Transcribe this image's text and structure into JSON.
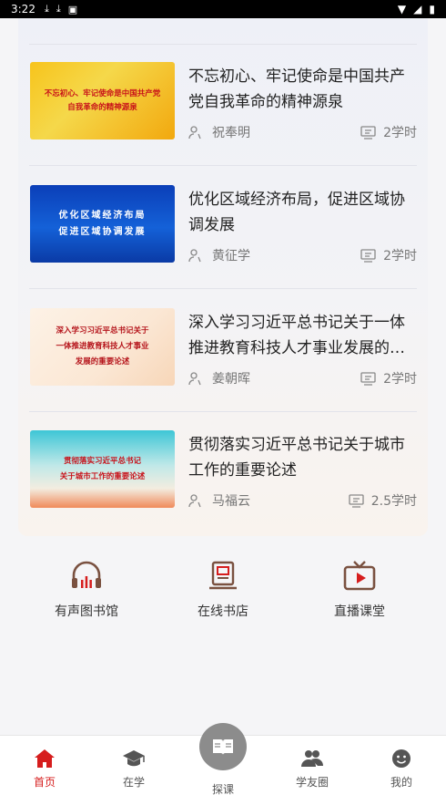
{
  "status_bar": {
    "time": "3:22"
  },
  "courses": [
    {
      "title": "不忘初心、牢记使命是中国共产党自我革命的精神源泉",
      "thumb_lines": [
        "不忘初心、牢记使命是中国共产党",
        "自我革命的精神源泉"
      ],
      "author": "祝奉明",
      "hours": "2学时"
    },
    {
      "title": "优化区域经济布局，促进区域协调发展",
      "thumb_lines": [
        "优化区域经济布局",
        "促进区域协调发展"
      ],
      "author": "黄征学",
      "hours": "2学时"
    },
    {
      "title": "深入学习习近平总书记关于一体推进教育科技人才事业发展的重要论述",
      "thumb_lines": [
        "深入学习习近平总书记关于",
        "一体推进教育科技人才事业",
        "发展的重要论述"
      ],
      "author": "姜朝晖",
      "hours": "2学时"
    },
    {
      "title": "贯彻落实习近平总书记关于城市工作的重要论述",
      "thumb_lines": [
        "贯彻落实习近平总书记",
        "关于城市工作的重要论述"
      ],
      "author": "马福云",
      "hours": "2.5学时"
    }
  ],
  "quick_entries": [
    {
      "label": "有声图书馆",
      "icon": "headphones-icon"
    },
    {
      "label": "在线书店",
      "icon": "bookstore-icon"
    },
    {
      "label": "直播课堂",
      "icon": "tv-icon"
    }
  ],
  "bottom_nav": [
    {
      "label": "首页",
      "icon": "home-icon",
      "active": true
    },
    {
      "label": "在学",
      "icon": "graduation-cap-icon"
    },
    {
      "label": "探课",
      "icon": "book-icon"
    },
    {
      "label": "学友圈",
      "icon": "users-icon"
    },
    {
      "label": "我的",
      "icon": "smile-icon"
    }
  ],
  "colors": {
    "accent": "#d61d1d",
    "icon_brown": "#7a5140"
  }
}
